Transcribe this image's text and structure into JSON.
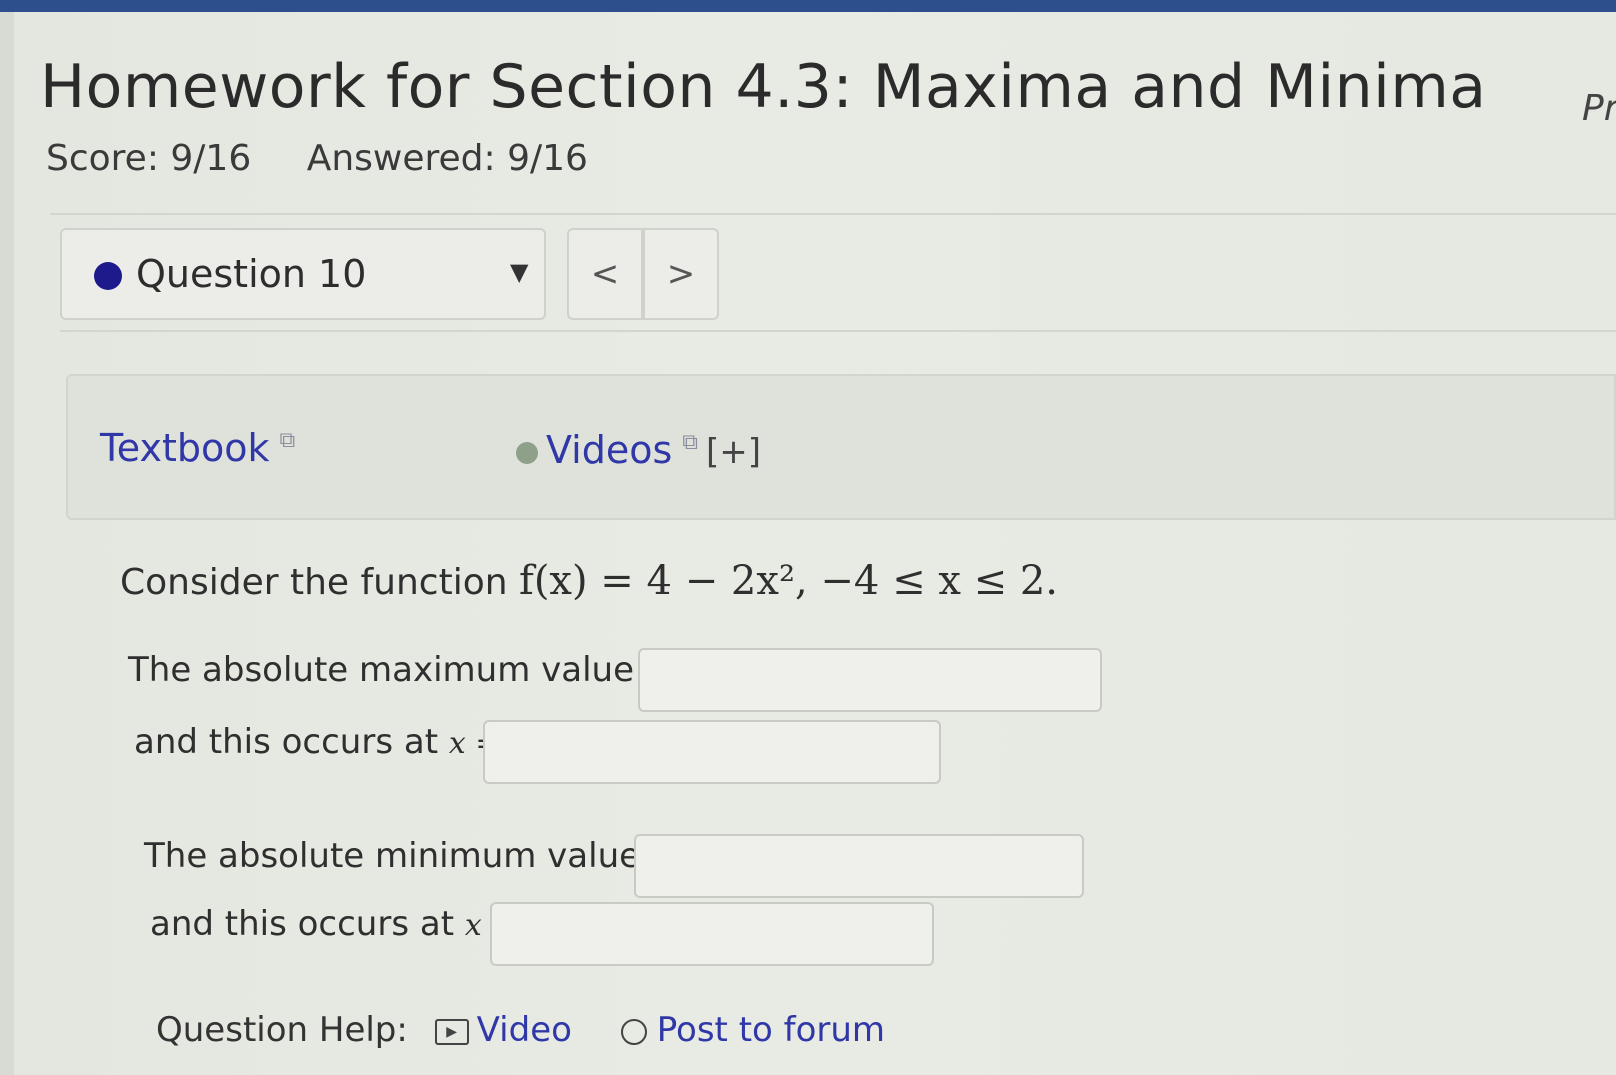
{
  "header": {
    "title": "Homework for Section 4.3: Maxima and Minima",
    "corner_text": "Pr",
    "score": "Score: 9/16",
    "answered": "Answered: 9/16"
  },
  "question_nav": {
    "selected": "Question 10",
    "prev_label": "<",
    "next_label": ">"
  },
  "resources": {
    "textbook": "Textbook",
    "videos": "Videos",
    "expand": "[+]"
  },
  "problem": {
    "intro": "Consider the function",
    "function": "f(x) = 4 − 2x², −4 ≤ x ≤ 2.",
    "max_value_label": "The absolute maximum value is",
    "max_at_label": "and this occurs at",
    "min_value_label": "The absolute minimum value is",
    "min_at_label": "and this occurs at",
    "var_label": "x ="
  },
  "help": {
    "label": "Question Help:",
    "video": "Video",
    "forum": "Post to forum"
  },
  "colors": {
    "link": "#3038a8",
    "topbar": "#2d4f8c",
    "status_dot": "#1e1a8c"
  }
}
